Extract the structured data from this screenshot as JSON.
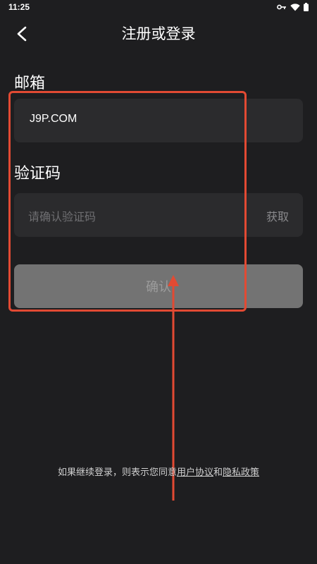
{
  "status_bar": {
    "time": "11:25"
  },
  "header": {
    "title": "注册或登录"
  },
  "form": {
    "email_label": "邮箱",
    "email_value": "J9P.COM",
    "code_label": "验证码",
    "code_placeholder": "请确认验证码",
    "get_code_label": "获取",
    "confirm_label": "确认"
  },
  "footer": {
    "prefix": "如果继续登录，则表示您同意",
    "user_agreement": "用户协议",
    "and": "和",
    "privacy_policy": "隐私政策"
  },
  "colors": {
    "background": "#1e1e20",
    "field_bg": "#2b2b2d",
    "button_disabled": "#737373",
    "annotation_red": "#e24a33"
  }
}
